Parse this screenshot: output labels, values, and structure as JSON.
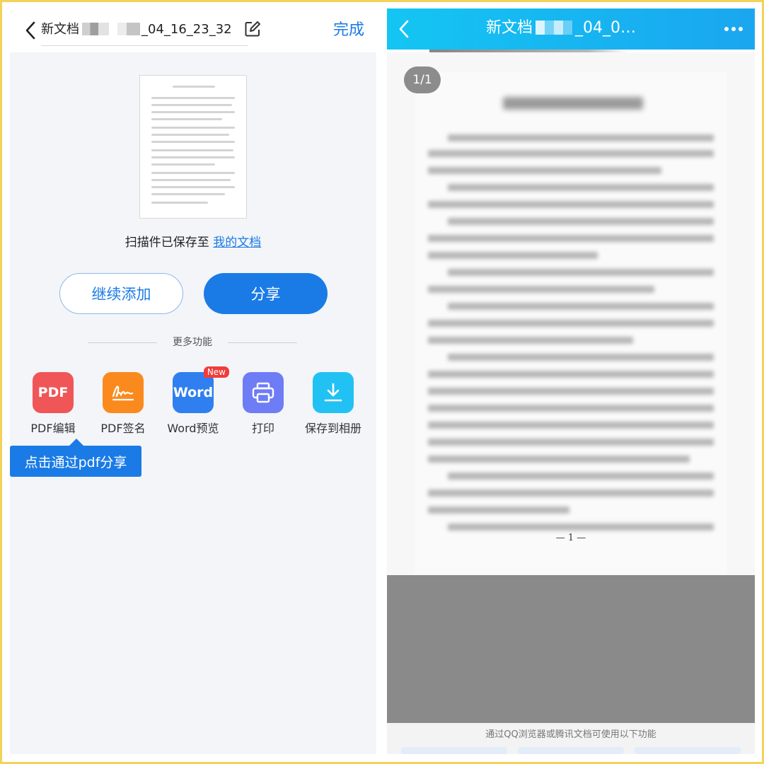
{
  "left": {
    "header": {
      "title_prefix": "新文档",
      "title_suffix": "_04_16_23_32",
      "done_label": "完成"
    },
    "saved": {
      "text": "扫描件已保存至 ",
      "link": "我的文档"
    },
    "actions": {
      "continue_label": "继续添加",
      "share_label": "分享"
    },
    "more_label": "更多功能",
    "tools": [
      {
        "label": "PDF编辑",
        "icon_text": "PDF",
        "color": "#f05658",
        "icon": "pdf-edit-icon"
      },
      {
        "label": "PDF签名",
        "icon_text": "",
        "color": "#fb8a1e",
        "icon": "signature-icon"
      },
      {
        "label": "Word预览",
        "icon_text": "Word",
        "color": "#2f7ff0",
        "icon": "word-icon",
        "badge": "New"
      },
      {
        "label": "打印",
        "icon_text": "",
        "color": "#6e7cf6",
        "icon": "printer-icon"
      },
      {
        "label": "保存到相册",
        "icon_text": "",
        "color": "#22c1f3",
        "icon": "download-icon"
      }
    ],
    "tooltip": "点击通过pdf分享"
  },
  "right": {
    "header": {
      "title_prefix": "新文档",
      "title_suffix": "_04_0…"
    },
    "page_indicator": "1/1",
    "page_number": "— 1 —",
    "footer_text": "通过QQ浏览器或腾讯文档可使用以下功能"
  },
  "colors": {
    "accent": "#1a7be6",
    "header_gradient_start": "#14c5f2",
    "header_gradient_end": "#1aa6f0",
    "frame": "#f2d25a"
  }
}
